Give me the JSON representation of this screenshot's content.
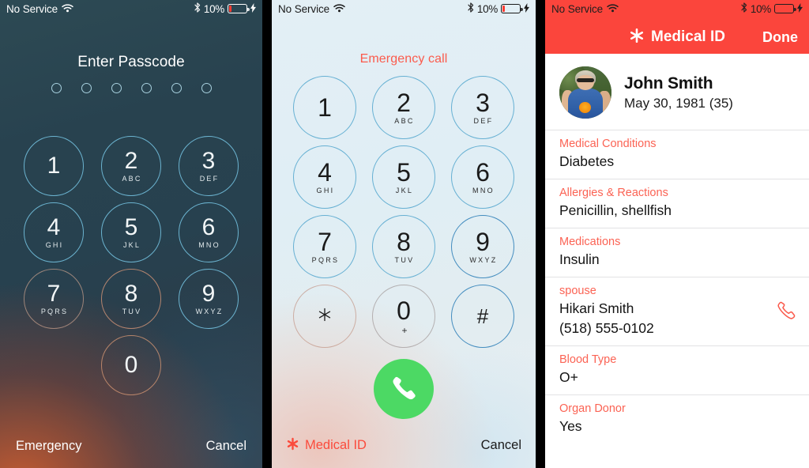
{
  "panels": {
    "lock": {
      "statusbar": {
        "carrier": "No Service",
        "wifi_icon": "wifi-icon",
        "bluetooth_icon": "bluetooth-icon",
        "battery_percent": "10%",
        "battery_icon": "battery-icon",
        "charging_icon": "lightning-bolt-icon"
      },
      "title": "Enter Passcode",
      "passcode_dots": 6,
      "keys": [
        {
          "num": "1",
          "sub": ""
        },
        {
          "num": "2",
          "sub": "ABC"
        },
        {
          "num": "3",
          "sub": "DEF"
        },
        {
          "num": "4",
          "sub": "GHI"
        },
        {
          "num": "5",
          "sub": "JKL"
        },
        {
          "num": "6",
          "sub": "MNO"
        },
        {
          "num": "7",
          "sub": "PQRS"
        },
        {
          "num": "8",
          "sub": "TUV"
        },
        {
          "num": "9",
          "sub": "WXYZ"
        },
        {
          "num": "0",
          "sub": ""
        }
      ],
      "emergency_label": "Emergency",
      "cancel_label": "Cancel"
    },
    "dialer": {
      "statusbar": {
        "carrier": "No Service",
        "wifi_icon": "wifi-icon",
        "bluetooth_icon": "bluetooth-icon",
        "battery_percent": "10%",
        "battery_icon": "battery-icon",
        "charging_icon": "lightning-bolt-icon"
      },
      "title": "Emergency call",
      "keys": [
        {
          "num": "1",
          "sub": ""
        },
        {
          "num": "2",
          "sub": "ABC"
        },
        {
          "num": "3",
          "sub": "DEF"
        },
        {
          "num": "4",
          "sub": "GHI"
        },
        {
          "num": "5",
          "sub": "JKL"
        },
        {
          "num": "6",
          "sub": "MNO"
        },
        {
          "num": "7",
          "sub": "PQRS"
        },
        {
          "num": "8",
          "sub": "TUV"
        },
        {
          "num": "9",
          "sub": "WXYZ"
        },
        {
          "num": "✳",
          "sub": ""
        },
        {
          "num": "0",
          "sub": "+"
        },
        {
          "num": "#",
          "sub": ""
        }
      ],
      "call_button_icon": "phone-handset-icon",
      "medical_id_label": "Medical ID",
      "medical_id_icon": "medical-asterisk-icon",
      "cancel_label": "Cancel"
    },
    "medical_id": {
      "statusbar": {
        "carrier": "No Service",
        "wifi_icon": "wifi-icon",
        "bluetooth_icon": "bluetooth-icon",
        "battery_percent": "10%",
        "battery_icon": "battery-icon",
        "charging_icon": "lightning-bolt-icon"
      },
      "nav_title": "Medical ID",
      "nav_icon": "medical-asterisk-icon",
      "done_label": "Done",
      "profile": {
        "avatar_icon": "profile-photo",
        "name": "John Smith",
        "dob": "May 30, 1981 (35)"
      },
      "rows": [
        {
          "label": "Medical Conditions",
          "value": "Diabetes",
          "call": false
        },
        {
          "label": "Allergies & Reactions",
          "value": "Penicillin, shellfish",
          "call": false
        },
        {
          "label": "Medications",
          "value": "Insulin",
          "call": false
        },
        {
          "label": "spouse",
          "value": "Hikari Smith\n(518) 555-0102",
          "call": true
        },
        {
          "label": "Blood Type",
          "value": "O+",
          "call": false
        },
        {
          "label": "Organ Donor",
          "value": "Yes",
          "call": false
        }
      ]
    }
  },
  "colors": {
    "accent_red": "#fb453c",
    "label_red": "#fb6354",
    "call_green": "#4cd964",
    "key_blue": "#50a5cd"
  }
}
